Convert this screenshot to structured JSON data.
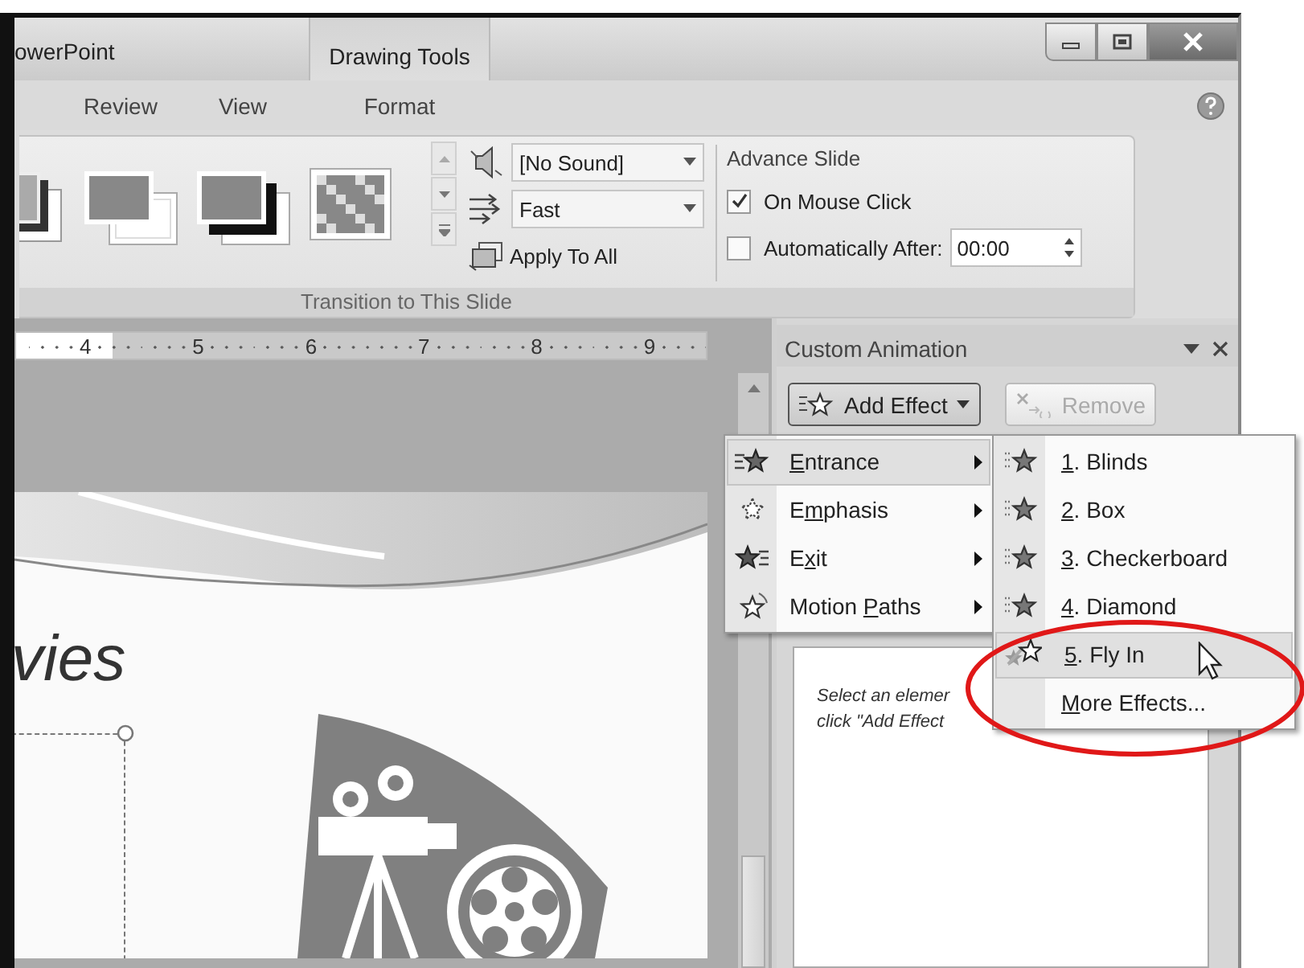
{
  "window": {
    "app_title": "owerPoint",
    "contextual_group": "Drawing Tools"
  },
  "tabs": [
    {
      "label": "Review",
      "selected": false
    },
    {
      "label": "View",
      "selected": false
    },
    {
      "label": "Format",
      "selected": false
    }
  ],
  "ribbon": {
    "gallery": [
      {
        "kind": "stack-dark"
      },
      {
        "kind": "stack-light"
      },
      {
        "kind": "stack-black"
      },
      {
        "kind": "checker"
      }
    ],
    "sound": {
      "value": "[No Sound]"
    },
    "speed": {
      "value": "Fast"
    },
    "apply_all": "Apply To All",
    "advance": {
      "title": "Advance Slide",
      "on_click": {
        "label": "On Mouse Click",
        "checked": true
      },
      "after": {
        "label": "Automatically After:",
        "checked": false,
        "value": "00:00"
      }
    },
    "group_label": "Transition to This Slide"
  },
  "ruler": [
    "4",
    "5",
    "6",
    "7",
    "8",
    "9"
  ],
  "slide": {
    "title": "vies"
  },
  "task_pane": {
    "title": "Custom Animation",
    "add_effect": {
      "label": "Add Effect",
      "expanded": true
    },
    "remove": {
      "label": "Remove",
      "disabled": true
    },
    "hint_lines": [
      "Select an elemer",
      "click \"Add Effect"
    ]
  },
  "effect_menu": [
    {
      "access_key": "E",
      "text_after": "ntrance",
      "kind": "entrance",
      "selected": true
    },
    {
      "text_before": "E",
      "access_key": "m",
      "text_after": "phasis",
      "kind": "emphasis",
      "selected": false
    },
    {
      "text_before": "E",
      "access_key": "x",
      "text_after": "it",
      "kind": "exit",
      "selected": false
    },
    {
      "text_before": "Motion ",
      "access_key": "P",
      "text_after": "aths",
      "kind": "motion",
      "selected": false
    }
  ],
  "entrance_menu": [
    {
      "access_key": "1",
      "text_after": ". Blinds",
      "kind": "effect",
      "selected": false
    },
    {
      "access_key": "2",
      "text_after": ". Box",
      "kind": "effect",
      "selected": false
    },
    {
      "access_key": "3",
      "text_after": ". Checkerboard",
      "kind": "effect",
      "selected": false
    },
    {
      "access_key": "4",
      "text_after": ". Diamond",
      "kind": "effect",
      "selected": false
    },
    {
      "access_key": "5",
      "text_after": ". Fly In",
      "kind": "flyin",
      "selected": true
    },
    {
      "access_key": "M",
      "text_after": "ore Effects...",
      "kind": "more",
      "selected": false
    }
  ]
}
